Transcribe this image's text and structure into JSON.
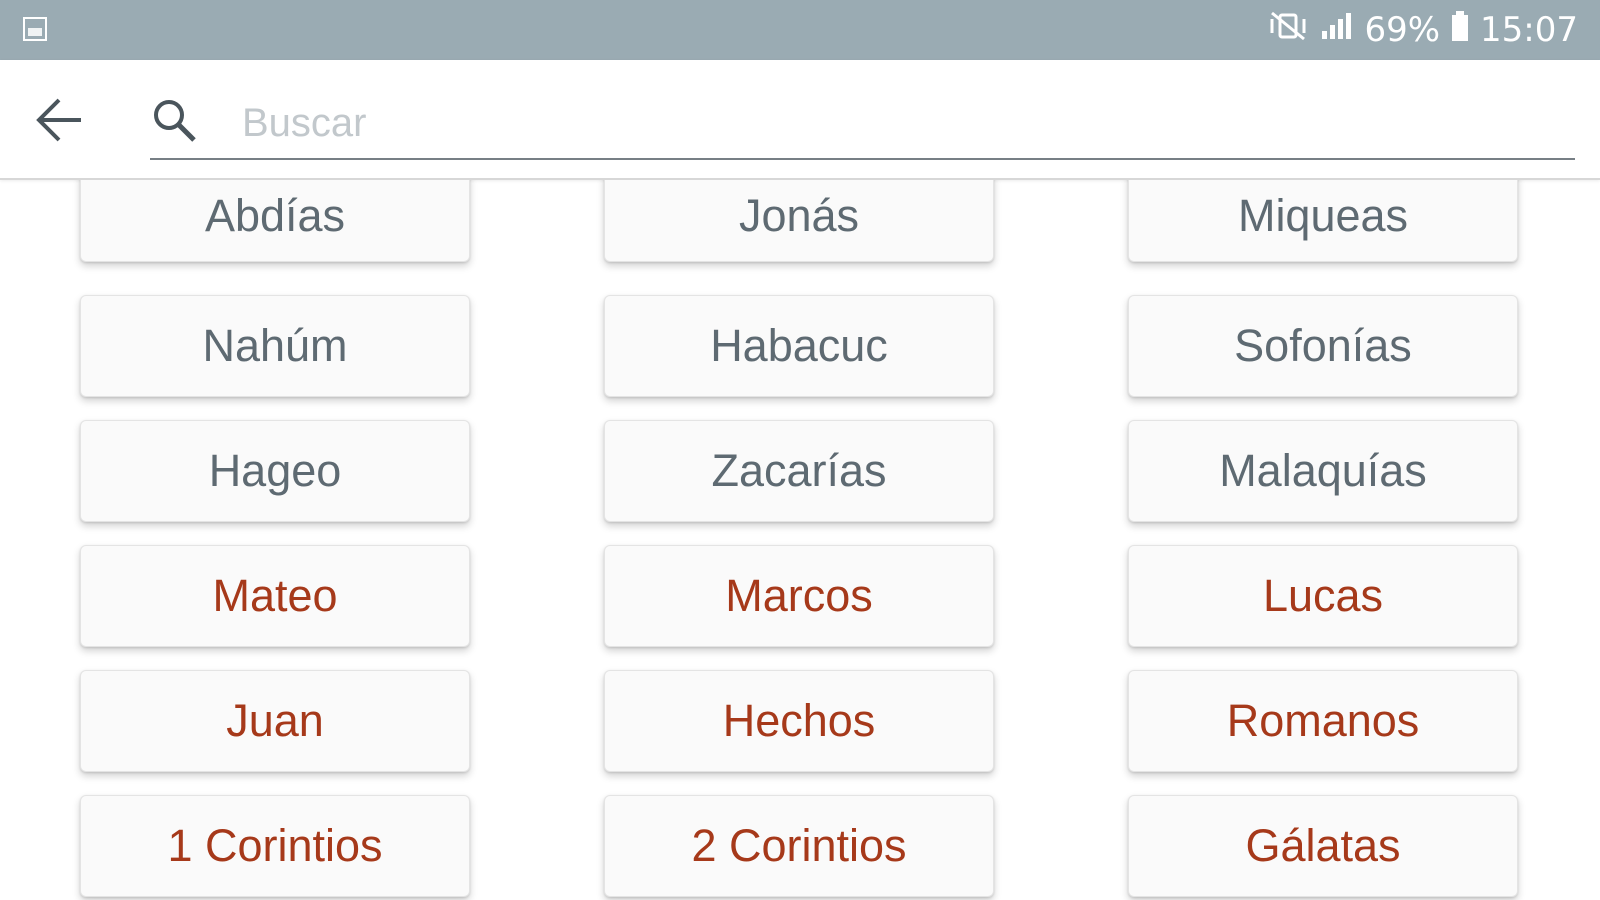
{
  "status_bar": {
    "left_icon": "image-icon",
    "mute_icon": "vibrate-mute-icon",
    "signal_icon": "signal-icon",
    "battery_percent": "69%",
    "battery_icon": "battery-icon",
    "time": "15:07"
  },
  "app_bar": {
    "back_icon": "arrow-back-icon",
    "search_icon": "search-icon",
    "search_placeholder": "Buscar",
    "search_value": ""
  },
  "colors": {
    "status_bar": "#9aabb3",
    "old_testament_text": "#5e6a72",
    "new_testament_text": "#a6391a",
    "button_bg": "#fafafa"
  },
  "books": {
    "r1": [
      "Abdías",
      "Jonás",
      "Miqueas"
    ],
    "r2": [
      "Nahúm",
      "Habacuc",
      "Sofonías"
    ],
    "r3": [
      "Hageo",
      "Zacarías",
      "Malaquías"
    ],
    "r4": [
      "Mateo",
      "Marcos",
      "Lucas"
    ],
    "r5": [
      "Juan",
      "Hechos",
      "Romanos"
    ],
    "r6": [
      "1 Corintios",
      "2 Corintios",
      "Gálatas"
    ]
  }
}
